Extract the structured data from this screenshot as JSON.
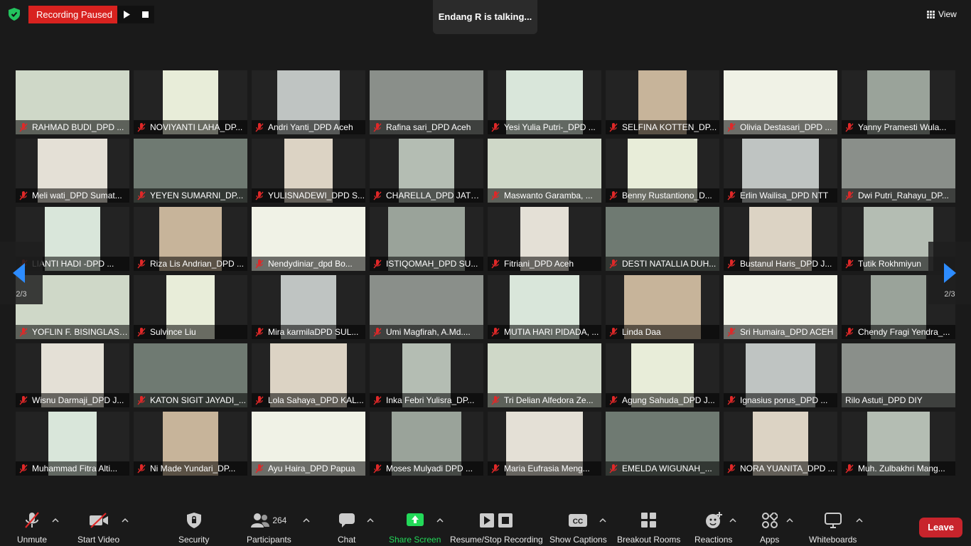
{
  "top": {
    "recording_label": "Recording Paused",
    "talking_label": "Endang R is talking...",
    "view_label": "View"
  },
  "pagination": {
    "left_page": "2/3",
    "right_page": "2/3"
  },
  "colors": {
    "recording_red": "#d8221f",
    "share_green": "#23d959",
    "leave_red": "#c8242c",
    "mic_off_red": "#e02828"
  },
  "participants": [
    {
      "name": "RAHMAD BUDI_DPD ...",
      "muted": true
    },
    {
      "name": "NOVIYANTI LAHA_DP...",
      "muted": true
    },
    {
      "name": "Andri Yanti_DPD Aceh",
      "muted": true
    },
    {
      "name": "Rafina sari_DPD Aceh",
      "muted": true
    },
    {
      "name": "Yesi Yulia Putri-_DPD ...",
      "muted": true
    },
    {
      "name": "SELFINA KOTTEN_DP...",
      "muted": true
    },
    {
      "name": "Olivia Destasari_DPD ...",
      "muted": true
    },
    {
      "name": "Yanny Pramesti Wula...",
      "muted": true
    },
    {
      "name": "Meli wati_DPD Sumat...",
      "muted": true
    },
    {
      "name": "YEYEN SUMARNI_DP...",
      "muted": true
    },
    {
      "name": "YULISNADEWI_DPD S...",
      "muted": true
    },
    {
      "name": "CHARELLA_DPD JATE...",
      "muted": true
    },
    {
      "name": "Maswanto Garamba, ...",
      "muted": true
    },
    {
      "name": "Benny Rustantiono_D...",
      "muted": true
    },
    {
      "name": "Erlin Wailisa_DPD NTT",
      "muted": true
    },
    {
      "name": "Dwi Putri_Rahayu_DP...",
      "muted": true
    },
    {
      "name": "LIANTI HADI -DPD ...",
      "muted": true
    },
    {
      "name": "Riza Lis Andrian_DPD ...",
      "muted": true
    },
    {
      "name": "Nendydiniar_dpd Bo...",
      "muted": true
    },
    {
      "name": "ISTIQOMAH_DPD SU...",
      "muted": true
    },
    {
      "name": "Fitriani_DPD Aceh",
      "muted": true
    },
    {
      "name": "DESTI NATALLIA DUH...",
      "muted": true
    },
    {
      "name": "Bustanul Haris_DPD J...",
      "muted": true
    },
    {
      "name": "Tutik Rokhmiyun",
      "muted": true
    },
    {
      "name": "YOFLIN F. BISINGLASI,...",
      "muted": true
    },
    {
      "name": "Sulvince Liu",
      "muted": true
    },
    {
      "name": "Mira karmilaDPD SUL...",
      "muted": true
    },
    {
      "name": "Umi Magfirah, A.Md....",
      "muted": true
    },
    {
      "name": "MUTIA HARI PIDADA, ...",
      "muted": true
    },
    {
      "name": "Linda Daa",
      "muted": true
    },
    {
      "name": "Sri Humaira_DPD ACEH",
      "muted": true
    },
    {
      "name": "Chendy Fragi Yendra_...",
      "muted": true
    },
    {
      "name": "Wisnu Darmaji_DPD J...",
      "muted": true
    },
    {
      "name": "KATON SIGIT JAYADI_...",
      "muted": true
    },
    {
      "name": "Lola Sahaya_DPD KAL...",
      "muted": true
    },
    {
      "name": "Inka Febri Yulisra_DP...",
      "muted": true
    },
    {
      "name": "Tri Delian Alfedora Ze...",
      "muted": true
    },
    {
      "name": "Agung Sahuda_DPD J...",
      "muted": true
    },
    {
      "name": "Ignasius porus_DPD ...",
      "muted": true
    },
    {
      "name": "Rilo Astuti_DPD DIY",
      "muted": false
    },
    {
      "name": "Muhammad Fitra Alti...",
      "muted": true
    },
    {
      "name": "Ni Made Yundari_DP...",
      "muted": true
    },
    {
      "name": "Ayu Haira_DPD Papua",
      "muted": true
    },
    {
      "name": "Moses Mulyadi DPD ...",
      "muted": true
    },
    {
      "name": "Maria Eufrasia Meng...",
      "muted": true
    },
    {
      "name": "EMELDA WIGUNAH_...",
      "muted": true
    },
    {
      "name": "NORA YUANITA_DPD ...",
      "muted": true
    },
    {
      "name": "Muh. Zulbakhri Mang...",
      "muted": true
    }
  ],
  "toolbar": {
    "unmute": "Unmute",
    "start_video": "Start Video",
    "security": "Security",
    "participants": "Participants",
    "participant_count": "264",
    "chat": "Chat",
    "share_screen": "Share Screen",
    "recording": "Resume/Stop Recording",
    "captions": "Show Captions",
    "breakout": "Breakout Rooms",
    "reactions": "Reactions",
    "apps": "Apps",
    "whiteboards": "Whiteboards",
    "leave": "Leave"
  }
}
